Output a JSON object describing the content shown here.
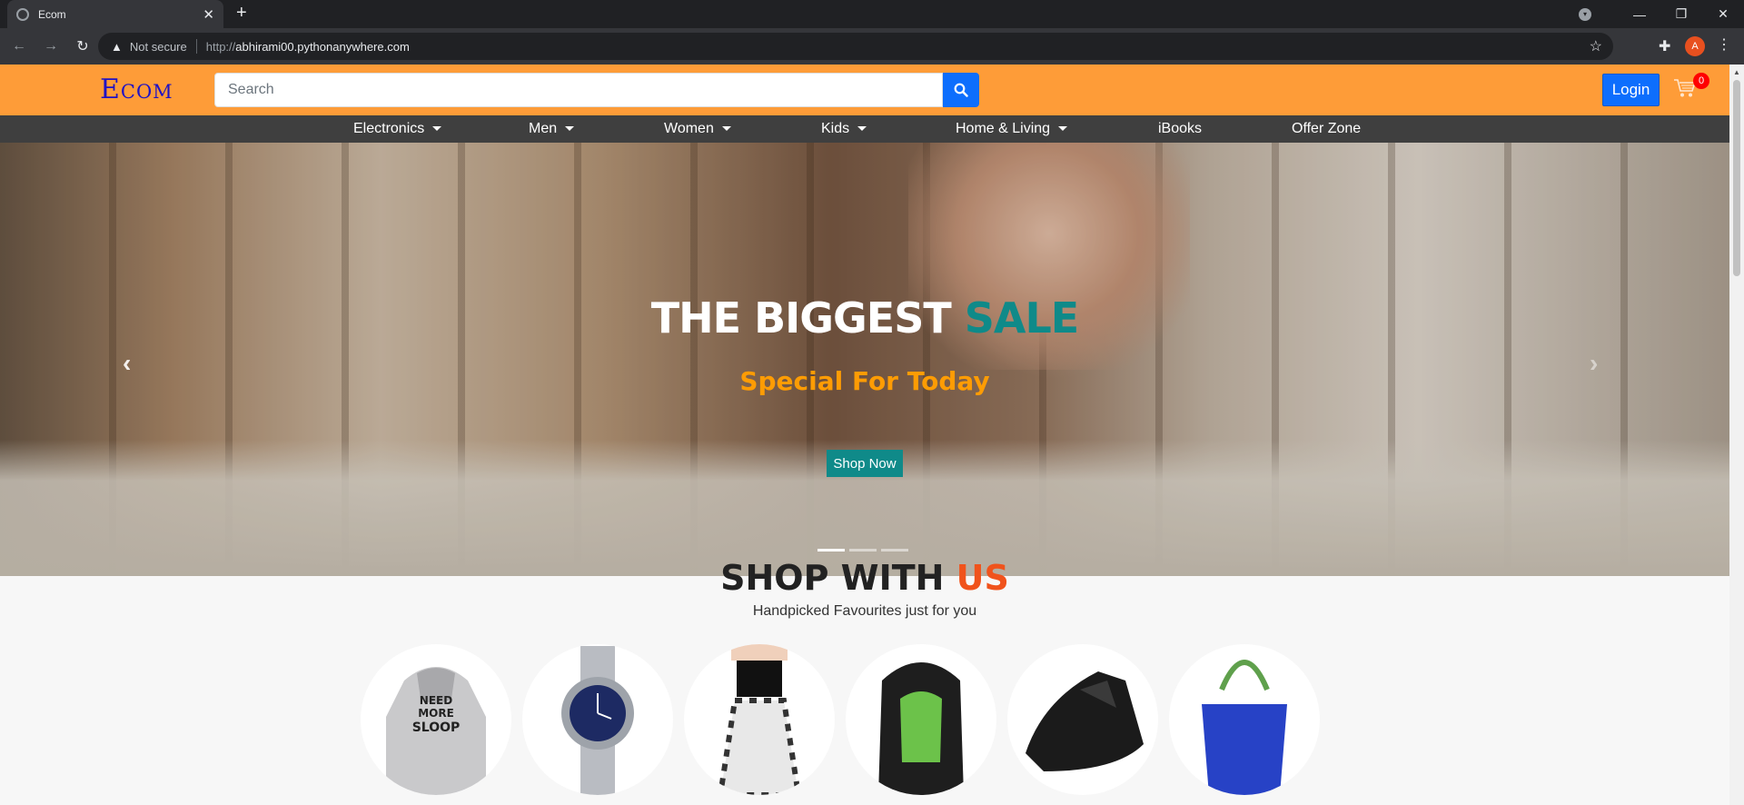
{
  "browser": {
    "tab_title": "Ecom",
    "new_tab": "+",
    "address": {
      "security_label": "Not secure",
      "protocol": "http://",
      "host": "abhirami00.pythonanywhere.com"
    },
    "profile_initial": "A"
  },
  "header": {
    "logo": "Ecom",
    "search_placeholder": "Search",
    "login_label": "Login",
    "cart_count": "0",
    "colors": {
      "header_bg": "#fe9c38",
      "primary": "#0d6efd",
      "nav_bg": "#3f3f3f"
    }
  },
  "nav": {
    "items": [
      {
        "label": "Electronics",
        "dropdown": true
      },
      {
        "label": "Men",
        "dropdown": true
      },
      {
        "label": "Women",
        "dropdown": true
      },
      {
        "label": "Kids",
        "dropdown": true
      },
      {
        "label": "Home & Living",
        "dropdown": true
      },
      {
        "label": "iBooks",
        "dropdown": false
      },
      {
        "label": "Offer Zone",
        "dropdown": false
      }
    ]
  },
  "hero": {
    "title_main": "THE BIGGEST ",
    "title_accent": "SALE",
    "subtitle": "Special For Today",
    "cta_label": "Shop Now",
    "prev_icon": "chevron-left-icon",
    "next_icon": "chevron-right-icon",
    "active_slide": 1,
    "slide_count": 3,
    "colors": {
      "accent": "#0f8a89",
      "subtitle": "#fe9c04"
    }
  },
  "shop": {
    "title_main": "SHOP WITH ",
    "title_accent": "US",
    "subtitle": "Handpicked Favourites just for you",
    "products": [
      {
        "name": "hoodie",
        "print": "NEED MORE SLOOP"
      },
      {
        "name": "watch"
      },
      {
        "name": "skirt-outfit"
      },
      {
        "name": "backpack"
      },
      {
        "name": "shoes"
      },
      {
        "name": "handbag"
      }
    ],
    "colors": {
      "accent": "#f0531c"
    }
  }
}
